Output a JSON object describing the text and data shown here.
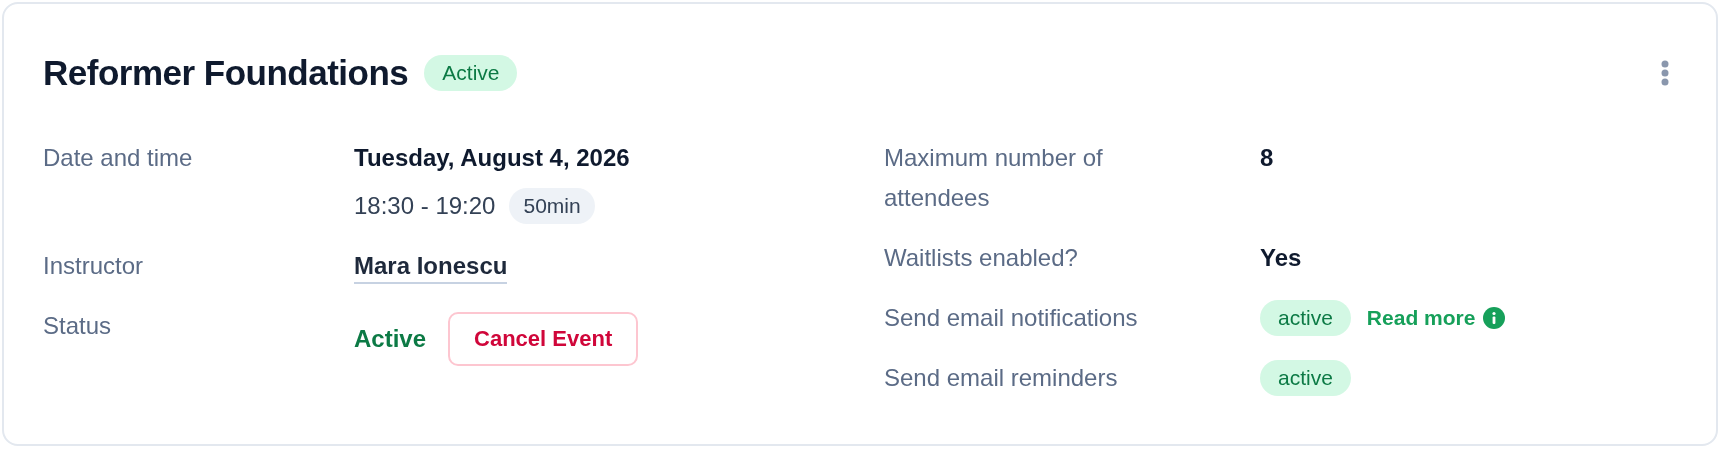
{
  "event": {
    "title": "Reformer Foundations",
    "status_badge": "Active"
  },
  "details_left": [
    {
      "label": "Date and time",
      "kind": "datetime",
      "value": "Tuesday, August 4, 2026",
      "time": "18:30 - 19:20",
      "duration": "50min"
    },
    {
      "label": "Instructor",
      "kind": "link",
      "value": "Mara Ionescu"
    },
    {
      "label": "Status",
      "kind": "status",
      "value": "Active",
      "action": "Cancel Event"
    }
  ],
  "details_right": [
    {
      "label": "Maximum number of attendees",
      "kind": "text",
      "value": "8"
    },
    {
      "label": "Waitlists enabled?",
      "kind": "text",
      "value": "Yes"
    },
    {
      "label": "Send email notifications",
      "kind": "badge",
      "value": "active",
      "link": "Read more"
    },
    {
      "label": "Send email reminders",
      "kind": "badge",
      "value": "active"
    }
  ]
}
